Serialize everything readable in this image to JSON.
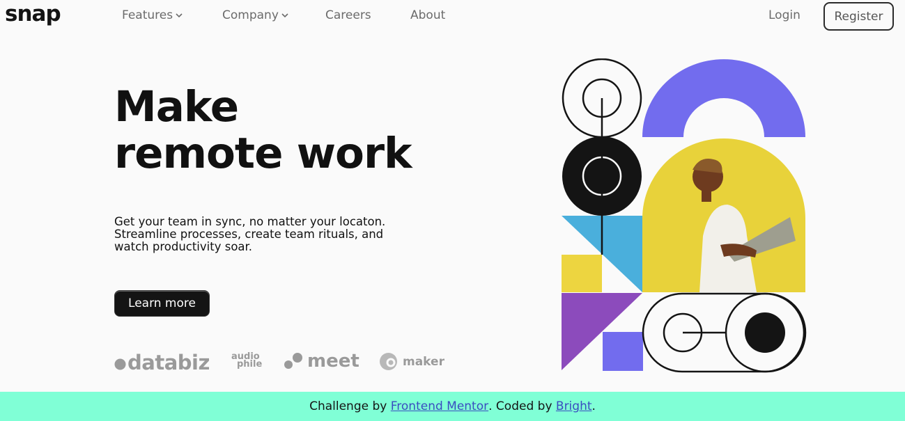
{
  "brand": {
    "logo": "snap"
  },
  "nav": {
    "items": [
      {
        "label": "Features",
        "has_dropdown": true
      },
      {
        "label": "Company",
        "has_dropdown": true
      },
      {
        "label": "Careers",
        "has_dropdown": false
      },
      {
        "label": "About",
        "has_dropdown": false
      }
    ],
    "login_label": "Login",
    "register_label": "Register"
  },
  "hero": {
    "title_line1": "Make",
    "title_line2": "remote work",
    "description_line1": "Get your team in sync, no matter your locaton.",
    "description_line2": "Streamline processes, create team rituals, and",
    "description_line3": "watch productivity soar.",
    "cta_label": "Learn more"
  },
  "clients": [
    {
      "name": "databiz",
      "icon": "databiz-logo-icon"
    },
    {
      "name": "audiophile",
      "text_line1": "audio",
      "text_line2": "phile",
      "icon": "audiophile-logo-icon"
    },
    {
      "name": "meet",
      "icon": "meet-logo-icon"
    },
    {
      "name": "maker",
      "icon": "maker-logo-icon"
    }
  ],
  "footer": {
    "prefix": "Challenge by ",
    "link1": "Frontend Mentor",
    "middle": ". Coded by ",
    "link2": "Bright",
    "suffix": "."
  },
  "colors": {
    "footer_bg": "#80ffd6",
    "purple": "#726cee",
    "yellow": "#edd540",
    "blue": "#4aafdc",
    "violet": "#8c4bbc",
    "dark": "#141414"
  }
}
